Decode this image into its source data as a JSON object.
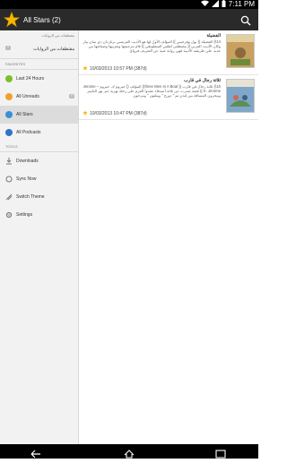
{
  "status": {
    "time": "7:11 PM"
  },
  "app": {
    "title": "All Stars (2)"
  },
  "drawer": {
    "top_label": "مقتطفات من الروايات",
    "feed_label": "مقتطفات من الروايات",
    "feed_count": "2",
    "sections": {
      "favorites": "FAVORITES",
      "tools": "TOOLS"
    },
    "favorites": [
      {
        "label": "Last 24 Hours"
      },
      {
        "label": "All Unreads",
        "count": "5"
      },
      {
        "label": "All Stars"
      },
      {
        "label": "All Podcasts"
      }
    ],
    "tools": [
      {
        "label": "Downloads"
      },
      {
        "label": "Sync Now"
      },
      {
        "label": "Switch Theme"
      },
      {
        "label": "Settings"
      }
    ]
  },
  "articles": [
    {
      "title": "الفضيلة",
      "desc": "14\\) الفضيلة (( بول وفرجيني )) المؤلف الأول لها هو الأديب الفرنسي برناردان دي سان بيار وكان الأديب العربي (( مصطفى لطفي المنفلوطي )) قام بترجمتها وتعريبها وصياغتها من جديد على طريقته الأدبية فهي رواية غنية عن التعريف فروائ",
      "date": "10/03/2013 10:57 PM (387d)"
    },
    {
      "title": "ثلاثة رجال في قارب",
      "desc": "10\\) ثلاثة رجال في قارب (( three Men In A Boat)) المؤلف (( جيروم ك. جيروم – Jerome K. Jerome )) قصة صدرت عن ثلاثة أصدقاء عقدوا العزم على رحلة نهرية عبر نهر التايمز ويبحرون المسافة بين لندن ثم \" دورج \" وبيلتون \" ومرحون",
      "date": "10/03/2013 10:47 PM (387d)"
    }
  ]
}
